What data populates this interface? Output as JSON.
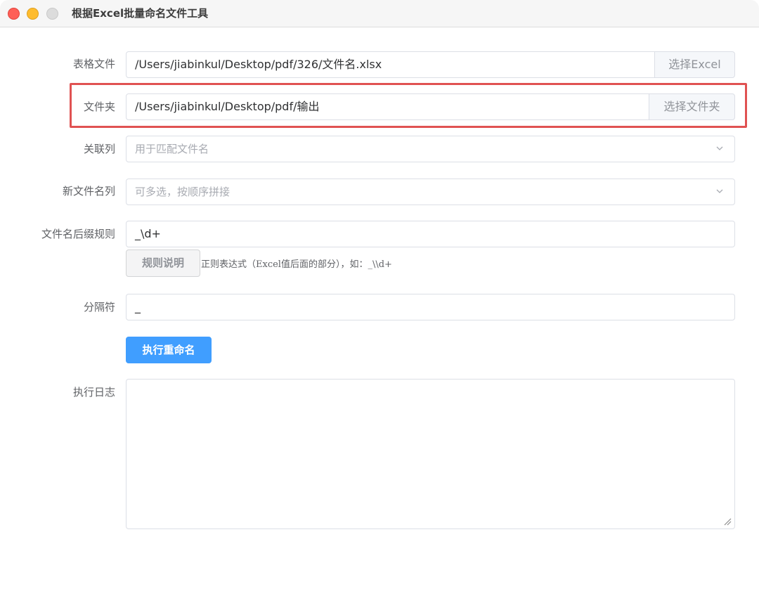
{
  "window": {
    "title": "根据Excel批量命名文件工具"
  },
  "form": {
    "excel_file": {
      "label": "表格文件",
      "value": "/Users/jiabinkul/Desktop/pdf/326/文件名.xlsx",
      "button": "选择Excel"
    },
    "folder": {
      "label": "文件夹",
      "value": "/Users/jiabinkul/Desktop/pdf/输出",
      "button": "选择文件夹"
    },
    "key_column": {
      "label": "关联列",
      "placeholder": "用于匹配文件名"
    },
    "new_name_columns": {
      "label": "新文件名列",
      "placeholder": "可多选，按顺序拼接"
    },
    "suffix_rule": {
      "label": "文件名后缀规则",
      "value": "_\\d+",
      "help_button": "规则说明",
      "hint": "正则表达式（Excel值后面的部分），如：_\\\\d+"
    },
    "separator": {
      "label": "分隔符",
      "value": "_"
    },
    "run_button": "执行重命名",
    "log": {
      "label": "执行日志",
      "value": ""
    }
  },
  "colors": {
    "primary": "#409eff",
    "highlight": "#e05252"
  }
}
